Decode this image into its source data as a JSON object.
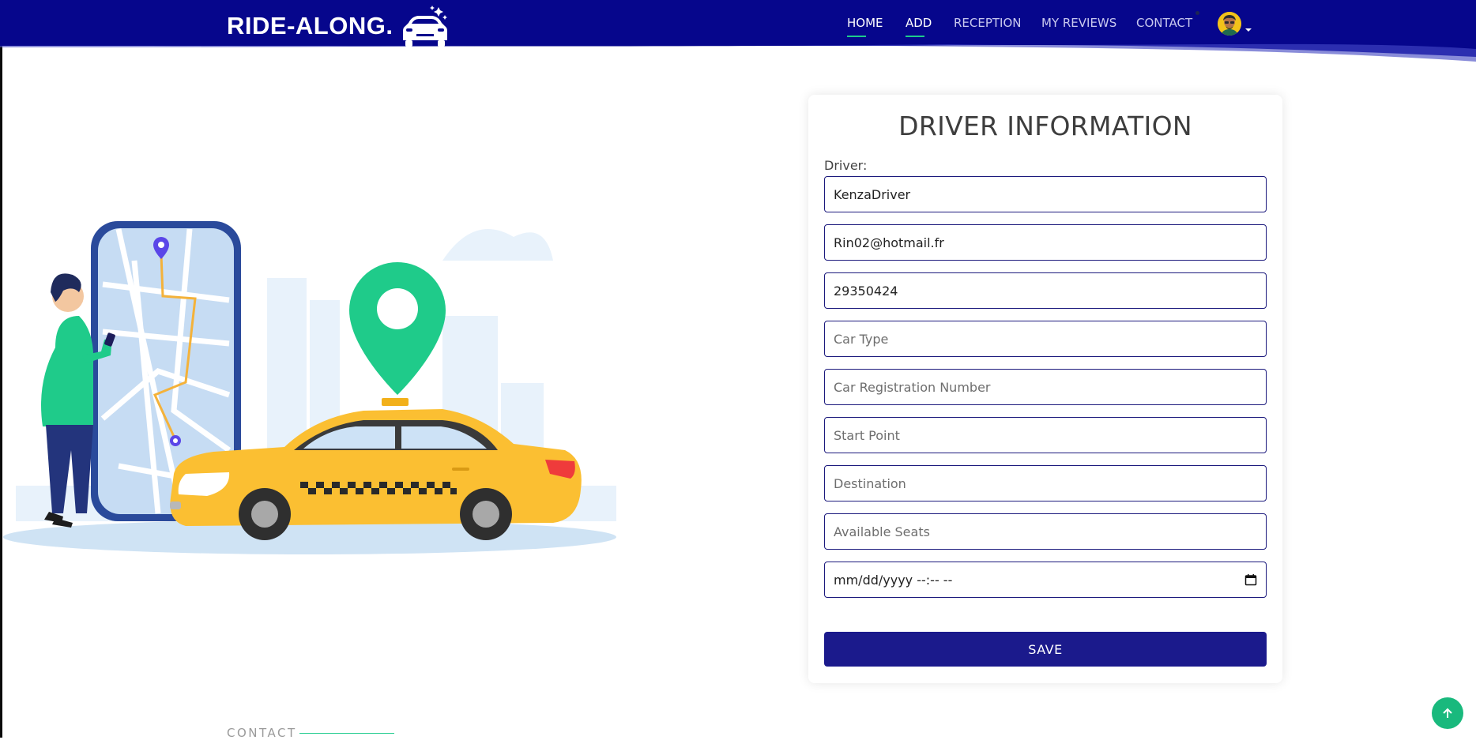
{
  "brand": {
    "name": "RIDE-ALONG.",
    "logo_icon": "car-icon"
  },
  "nav": {
    "items": [
      {
        "label": "HOME",
        "active": true
      },
      {
        "label": "ADD",
        "active": true
      },
      {
        "label": "RECEPTION",
        "active": false
      },
      {
        "label": "MY REVIEWS",
        "active": false
      },
      {
        "label": "CONTACT",
        "active": false
      }
    ],
    "avatar_icon": "user-avatar-icon"
  },
  "form": {
    "title": "DRIVER INFORMATION",
    "driver_label": "Driver:",
    "fields": [
      {
        "value": "KenzaDriver",
        "placeholder": ""
      },
      {
        "value": "Rin02@hotmail.fr",
        "placeholder": ""
      },
      {
        "value": "29350424",
        "placeholder": ""
      },
      {
        "value": "",
        "placeholder": "Car Type"
      },
      {
        "value": "",
        "placeholder": "Car Registration Number"
      },
      {
        "value": "",
        "placeholder": "Start Point"
      },
      {
        "value": "",
        "placeholder": "Destination"
      },
      {
        "value": "",
        "placeholder": "Available Seats"
      }
    ],
    "datetime_text": "mm/dd/yyyy --:-- --",
    "save_label": "SAVE"
  },
  "footer": {
    "contact_label": "CONTACT"
  },
  "colors": {
    "header": "#06068c",
    "accent": "#1ecb8c",
    "button": "#1b1a8c",
    "taxi": "#fbbf32"
  }
}
